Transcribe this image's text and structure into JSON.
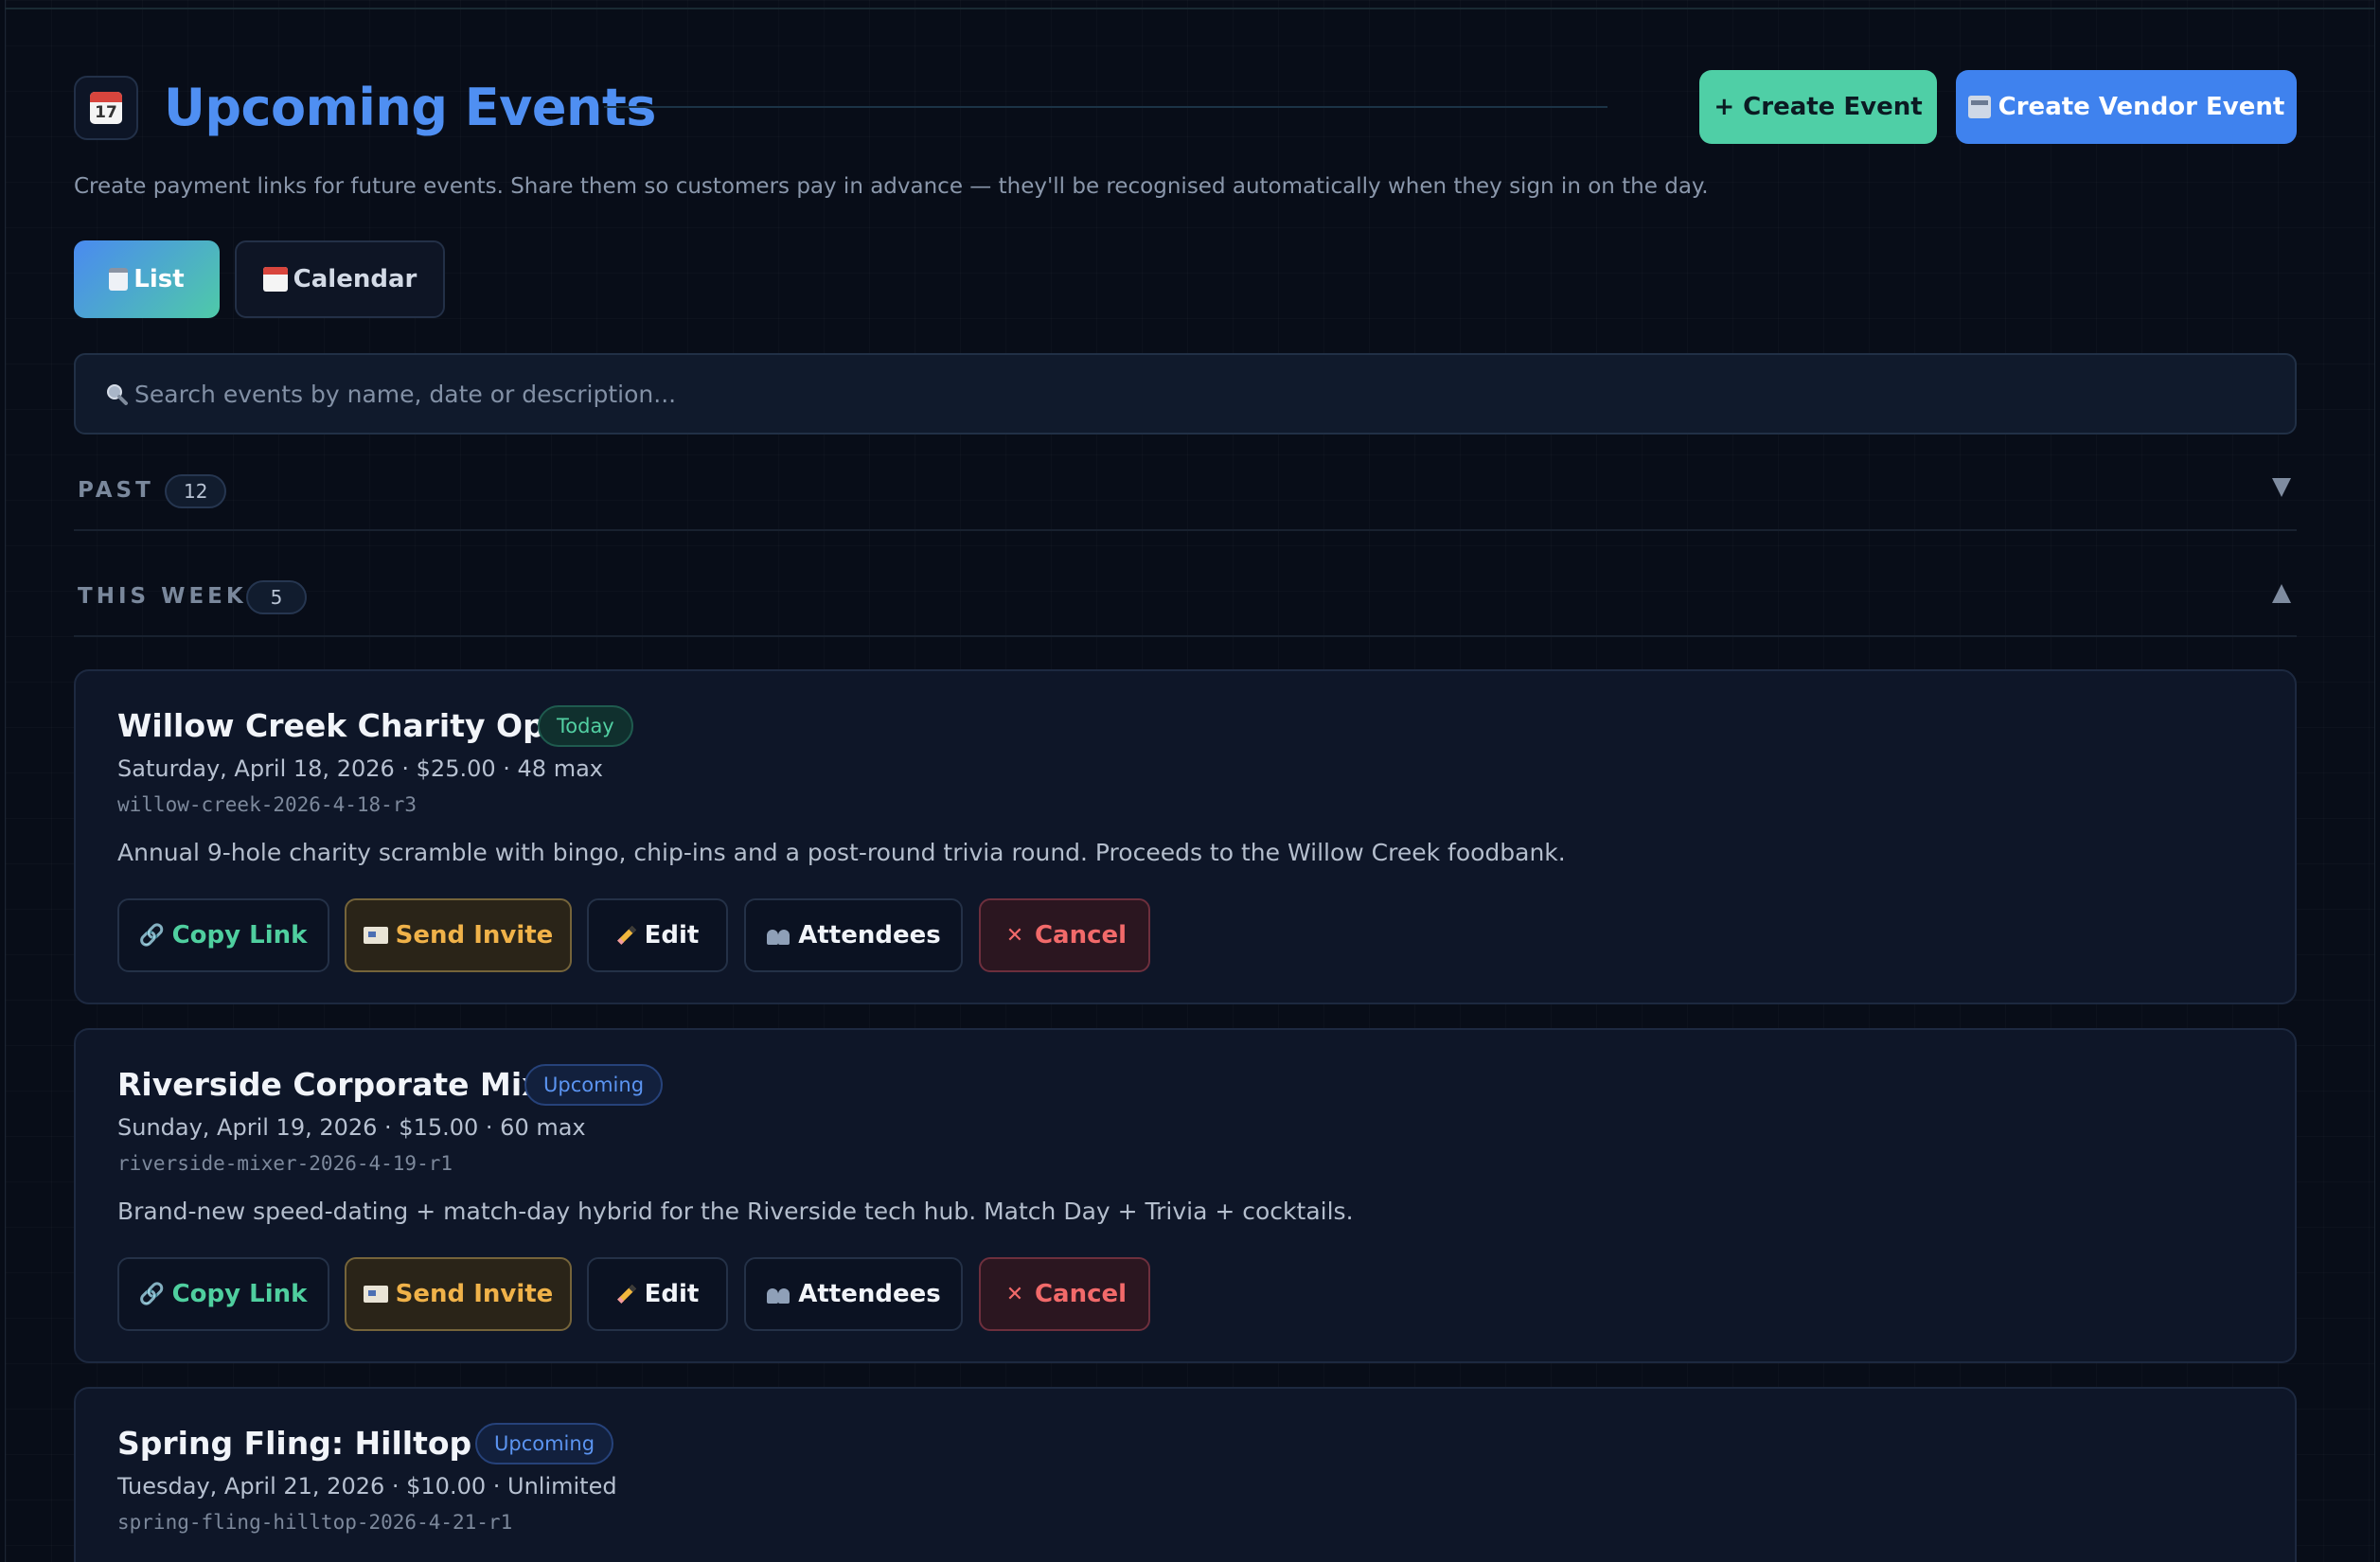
{
  "header": {
    "title": "Upcoming Events",
    "subtitle": "Create payment links for future events. Share them so customers pay in advance — they'll be recognised automatically when they sign in on the day.",
    "create_event_label": "+ Create Event",
    "create_vendor_event_label": "Create Vendor Event",
    "title_icon_day": "17"
  },
  "view_tabs": {
    "list_label": "List",
    "calendar_label": "Calendar",
    "active": "List"
  },
  "search": {
    "placeholder": "Search events by name, date or description..."
  },
  "sections": {
    "past": {
      "label": "PAST",
      "count": "12",
      "expanded": false
    },
    "this_week": {
      "label": "THIS WEEK",
      "count": "5",
      "expanded": true
    }
  },
  "events": [
    {
      "title": "Willow Creek Charity Open",
      "badge": "Today",
      "meta": "Saturday, April 18, 2026 · $25.00 · 48 max",
      "slug": "willow-creek-2026-4-18-r3",
      "description": "Annual 9-hole charity scramble with bingo, chip-ins and a post-round trivia round. Proceeds to the Willow Creek foodbank."
    },
    {
      "title": "Riverside Corporate Mixer",
      "badge": "Upcoming",
      "meta": "Sunday, April 19, 2026 · $15.00 · 60 max",
      "slug": "riverside-mixer-2026-4-19-r1",
      "description": "Brand-new speed-dating + match-day hybrid for the Riverside tech hub. Match Day + Trivia + cocktails."
    },
    {
      "title": "Spring Fling: Hilltop HQ",
      "badge": "Upcoming",
      "meta": "Tuesday, April 21, 2026 · $10.00 · Unlimited",
      "slug": "spring-fling-hilltop-2026-4-21-r1"
    }
  ],
  "actions": {
    "copy_link": "Copy Link",
    "send_invite": "Send Invite",
    "edit": "Edit",
    "attendees": "Attendees",
    "cancel": "Cancel"
  },
  "colors": {
    "background": "#080d18",
    "title_blue": "#4f8ff2",
    "accent_green": "#4fcfa6",
    "accent_blue": "#3f82ee",
    "invite_amber": "#f0b249",
    "cancel_red": "#f26a6a"
  },
  "icons": {
    "title": "calendar-icon",
    "vendor": "shop-icon",
    "list_tab": "clipboard-icon",
    "calendar_tab": "calendar-icon",
    "search": "magnifier-icon",
    "copy_link": "link-icon",
    "send_invite": "envelope-icon",
    "edit": "pencil-icon",
    "attendees": "people-icon",
    "cancel": "x-icon"
  }
}
